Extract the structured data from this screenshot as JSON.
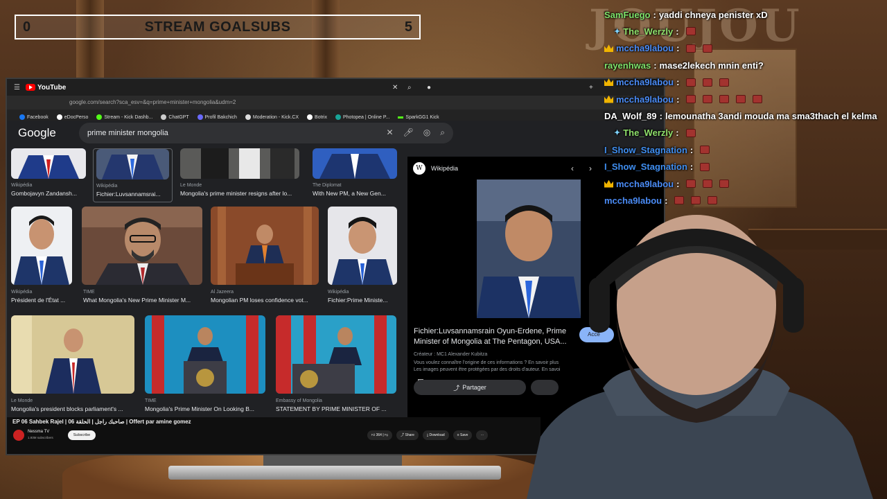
{
  "overlay": {
    "goal": {
      "start": "0",
      "title": "STREAM GOALSUBS",
      "end": "5"
    }
  },
  "browser": {
    "tab": {
      "site": "YouTube"
    },
    "address": "google.com/search?sca_esv=&q=prime+minister+mongolia&udm=2",
    "bookmarks": [
      "Facebook",
      "eDocPerso",
      "Stream - Kick Dashb...",
      "ChatGPT",
      "Profil Bakchich",
      "Moderation - Kick.CX",
      "Botrix",
      "Photopea | Online P...",
      "SparkGG1 Kick"
    ],
    "google": {
      "logo": "Google",
      "query": "prime minister mongolia"
    },
    "results": [
      {
        "source": "Wikipédia",
        "caption": "Gombojavyn Zandansh..."
      },
      {
        "source": "Wikipédia",
        "caption": "Fichier:Luvsannamsrai..."
      },
      {
        "source": "Le Monde",
        "caption": "Mongolia's prime minister resigns after lo..."
      },
      {
        "source": "The Diplomat",
        "caption": "With New PM, a New Gen..."
      },
      {
        "source": "Wikipédia",
        "caption": "Président de l'État ..."
      },
      {
        "source": "TIME",
        "caption": "What Mongolia's New Prime Minister M..."
      },
      {
        "source": "Al Jazeera",
        "caption": "Mongolian PM loses confidence vot..."
      },
      {
        "source": "Wikipédia",
        "caption": "Fichier:Prime Ministe..."
      },
      {
        "source": "Le Monde",
        "caption": "Mongolia's president blocks parliament's ..."
      },
      {
        "source": "TIME",
        "caption": "Mongolia's Prime Minister On Looking B..."
      },
      {
        "source": "Embassy of Mongolia",
        "caption": "STATEMENT BY PRIME MINISTER OF ..."
      }
    ],
    "preview": {
      "source": "Wikipédia",
      "title": "Fichier:Luvsannamsrain Oyun-Erdene, Prime Minister of Mongolia at The Pentagon, USA...",
      "access": "Accé",
      "creator": "Créateur : MC1 Alexander Kubitza",
      "info1": "Vous voulez connaître l'origine de ces informations ? En savoir plus",
      "info2": "Les images peuvent être protégées par des droits d'auteur. En savoi",
      "share": "Partager"
    }
  },
  "youtube": {
    "title": "EP 06 Sahbek Rajel | صاحبك راجل | الحلقة 06 | Offert par amine gomez",
    "channel": "Nessma TV",
    "subs": "1.93M subscribers",
    "subscribe": "Subscribe",
    "likes": "364",
    "share": "Share",
    "download": "Download",
    "save": "Save"
  },
  "chat": [
    {
      "user": "SamFuego",
      "color": "#7ee36a",
      "text": "yaddi chneya penister xD",
      "emotes": 0,
      "badge": ""
    },
    {
      "user": "The_Werzly",
      "color": "#8fe06b",
      "text": "",
      "emotes": 1,
      "badge": "sparkle"
    },
    {
      "user": "mccha9labou",
      "color": "#4a8bf5",
      "text": "",
      "emotes": 2,
      "badge": "crown"
    },
    {
      "user": "rayenhwas",
      "color": "#7ee36a",
      "text": "mase2lekech mnin enti?",
      "emotes": 0,
      "badge": ""
    },
    {
      "user": "mccha9labou",
      "color": "#4a8bf5",
      "text": "",
      "emotes": 3,
      "badge": "crown"
    },
    {
      "user": "mccha9labou",
      "color": "#4a8bf5",
      "text": "",
      "emotes": 5,
      "badge": "crown"
    },
    {
      "user": "DA_Wolf_89",
      "color": "#ffffff",
      "text": "lemounatha 3andi mouda ma sma3thach el kelma",
      "emotes": 0,
      "badge": ""
    },
    {
      "user": "The_Werzly",
      "color": "#8fe06b",
      "text": "",
      "emotes": 1,
      "badge": "sparkle"
    },
    {
      "user": "I_Show_Stagnation",
      "color": "#3f8ef0",
      "text": "",
      "emotes": 1,
      "badge": ""
    },
    {
      "user": "I_Show_Stagnation",
      "color": "#3f8ef0",
      "text": "",
      "emotes": 1,
      "badge": ""
    },
    {
      "user": "mccha9labou",
      "color": "#4a8bf5",
      "text": "",
      "emotes": 3,
      "badge": "crown"
    },
    {
      "user": "mccha9labou",
      "color": "#4a8bf5",
      "text": "",
      "emotes": 3,
      "badge": ""
    }
  ]
}
